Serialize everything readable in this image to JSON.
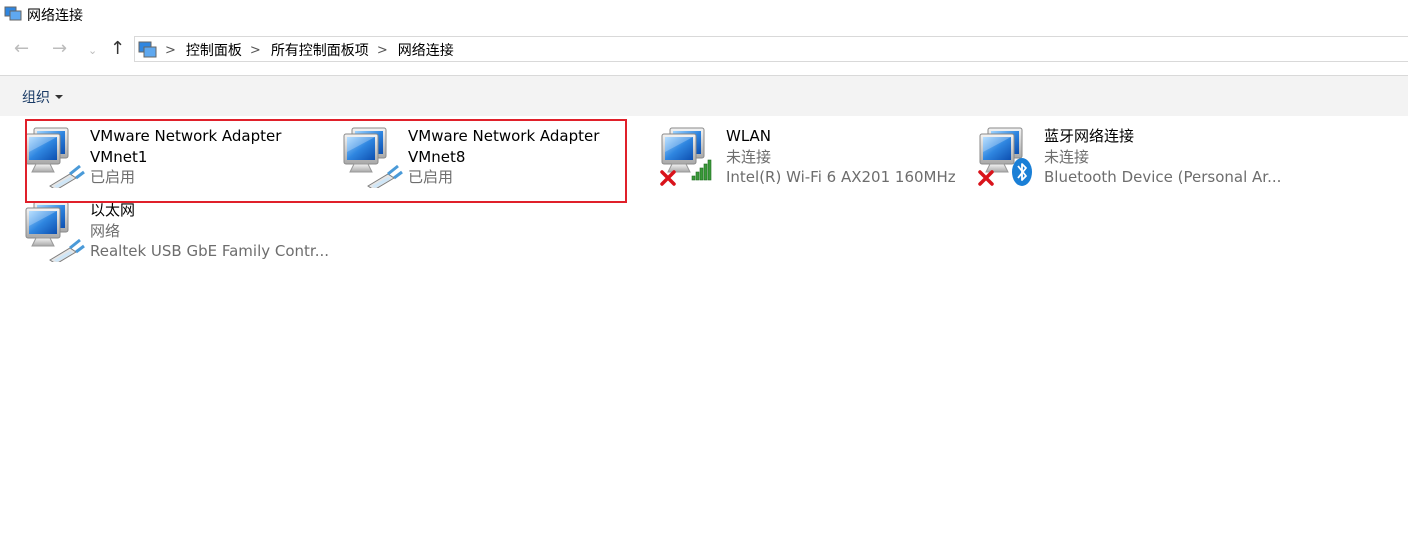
{
  "window": {
    "title": "网络连接",
    "icon": "network-connections-icon"
  },
  "nav": {
    "back_icon": "arrow-left-icon",
    "forward_icon": "arrow-right-icon",
    "recent_icon": "chevron-down-icon",
    "up_icon": "arrow-up-icon",
    "breadcrumbs": [
      "控制面板",
      "所有控制面板项",
      "网络连接"
    ]
  },
  "toolbar": {
    "organize_label": "组织"
  },
  "connections": [
    {
      "name": "VMware Network Adapter",
      "name2": "VMnet1",
      "status": "已启用",
      "device": "",
      "icon": "wired-adapter-icon"
    },
    {
      "name": "VMware Network Adapter",
      "name2": "VMnet8",
      "status": "已启用",
      "device": "",
      "icon": "wired-adapter-icon"
    },
    {
      "name": "WLAN",
      "status": "未连接",
      "device": "Intel(R) Wi-Fi 6 AX201 160MHz",
      "icon": "wifi-adapter-icon",
      "disconnected": true
    },
    {
      "name": "蓝牙网络连接",
      "status": "未连接",
      "device": "Bluetooth Device (Personal Ar...",
      "icon": "bluetooth-adapter-icon",
      "disconnected": true
    },
    {
      "name": "以太网",
      "status": "网络",
      "device": "Realtek USB GbE Family Contr...",
      "icon": "ethernet-adapter-icon"
    }
  ],
  "colors": {
    "highlight": "#e0202a",
    "toolbar_bg": "#f3f3f3"
  }
}
